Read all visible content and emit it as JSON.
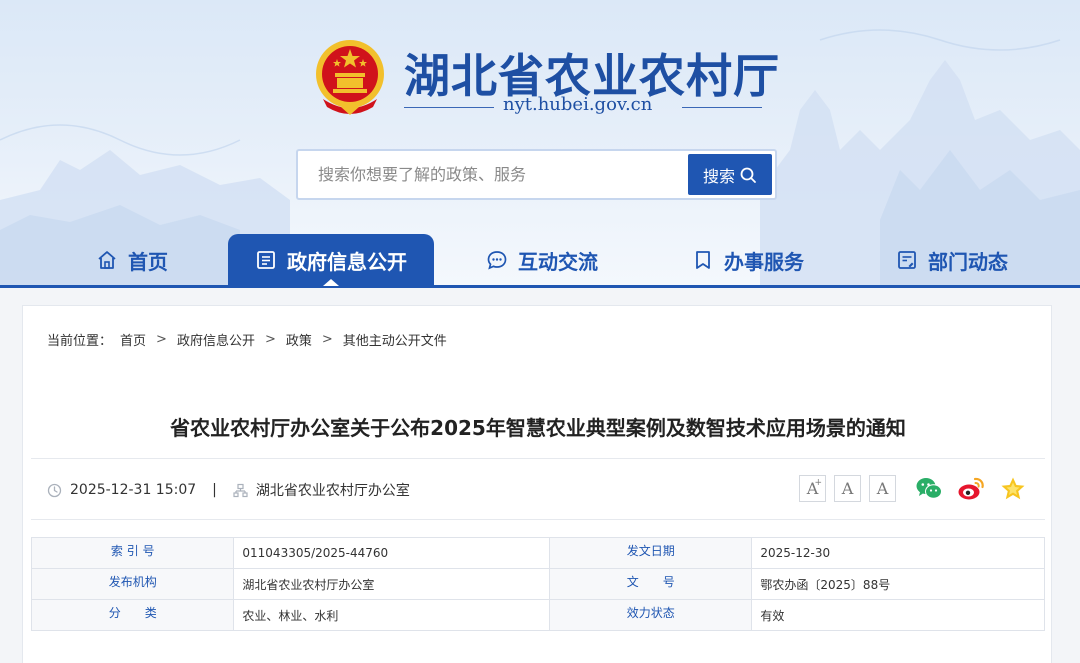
{
  "header": {
    "site_title": "湖北省农业农村厅",
    "site_domain": "nyt.hubei.gov.cn"
  },
  "search": {
    "placeholder": "搜索你想要了解的政策、服务",
    "button_label": "搜索"
  },
  "nav": {
    "items": [
      {
        "label": "首页",
        "icon": "home-icon",
        "active": false
      },
      {
        "label": "政府信息公开",
        "icon": "document-icon",
        "active": true
      },
      {
        "label": "互动交流",
        "icon": "chat-icon",
        "active": false
      },
      {
        "label": "办事服务",
        "icon": "bookmark-icon",
        "active": false
      },
      {
        "label": "部门动态",
        "icon": "news-icon",
        "active": false
      }
    ]
  },
  "breadcrumb": {
    "prefix": "当前位置：",
    "items": [
      "首页",
      "政府信息公开",
      "政策",
      "其他主动公开文件"
    ],
    "separator": ">"
  },
  "article": {
    "title": "省农业农村厅办公室关于公布2025年智慧农业典型案例及数智技术应用场景的通知",
    "datetime": "2025-12-31 15:07",
    "divider": "|",
    "source": "湖北省农业农村厅办公室"
  },
  "font_controls": {
    "increase": "A",
    "increase_mark": "+",
    "default": "A",
    "decrease": "A"
  },
  "share": [
    "wechat-icon",
    "weibo-icon",
    "favorite-star-icon"
  ],
  "info_table": {
    "rows": [
      {
        "k1": "索 引 号",
        "v1": "011043305/2025-44760",
        "k2": "发文日期",
        "v2": "2025-12-30"
      },
      {
        "k1": "发布机构",
        "v1": "湖北省农业农村厅办公室",
        "k2": "文　　号",
        "v2": "鄂农办函〔2025〕88号"
      },
      {
        "k1": "分　　类",
        "v1": "农业、林业、水利",
        "k2": "效力状态",
        "v2": "有效"
      }
    ]
  },
  "colors": {
    "brand": "#1f56b2",
    "title": "#1e4fa3",
    "emblem_red": "#d0121b",
    "emblem_gold": "#f2c02c"
  }
}
